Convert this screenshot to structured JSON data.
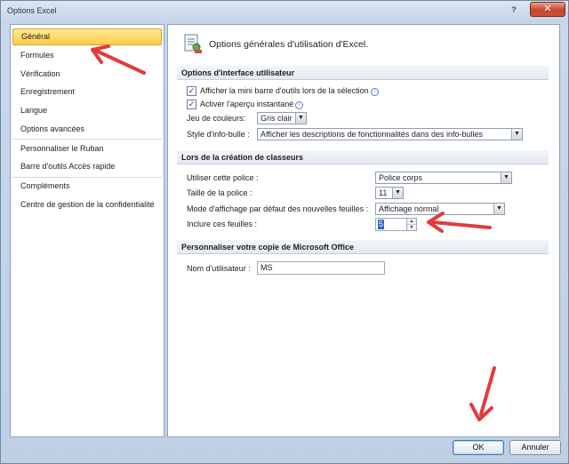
{
  "window": {
    "title": "Options Excel",
    "help_glyph": "?",
    "close_glyph": "✕"
  },
  "nav": {
    "items": [
      {
        "label": "Général"
      },
      {
        "label": "Formules"
      },
      {
        "label": "Vérification"
      },
      {
        "label": "Enregistrement"
      },
      {
        "label": "Langue"
      },
      {
        "label": "Options avancées"
      },
      {
        "label": "Personnaliser le Ruban"
      },
      {
        "label": "Barre d'outils Accès rapide"
      },
      {
        "label": "Compléments"
      },
      {
        "label": "Centre de gestion de la confidentialité"
      }
    ]
  },
  "main": {
    "heading": "Options générales d'utilisation d'Excel.",
    "ui_section": {
      "title": "Options d'interface utilisateur",
      "mini_toolbar_label": "Afficher la mini barre d'outils lors de la sélection",
      "live_preview_label": "Activer l'aperçu instantané",
      "color_scheme_label": "Jeu de couleurs:",
      "color_scheme_value": "Gris clair",
      "tooltip_style_label": "Style d'info-bulle :",
      "tooltip_style_value": "Afficher les descriptions de fonctionnalités dans des info-bulles"
    },
    "workbook_section": {
      "title": "Lors de la création de classeurs",
      "font_label": "Utiliser cette police :",
      "font_value": "Police corps",
      "size_label": "Taille de la police :",
      "size_value": "11",
      "view_label": "Mode d'affichage par défaut des nouvelles feuilles :",
      "view_value": "Affichage normal",
      "sheets_label": "Inclure ces feuilles :",
      "sheets_value": "5"
    },
    "personalize_section": {
      "title": "Personnaliser votre copie de Microsoft Office",
      "username_label": "Nom d'utilisateur :",
      "username_value": "MS"
    }
  },
  "footer": {
    "ok_label": "OK",
    "cancel_label": "Annuler"
  },
  "glyphs": {
    "check": "✓",
    "info": "i",
    "dropdown": "▼",
    "spin_up": "▲",
    "spin_down": "▼"
  },
  "colors": {
    "selected_nav": "#ffd55a",
    "annotation_arrow": "#e23b3b"
  }
}
